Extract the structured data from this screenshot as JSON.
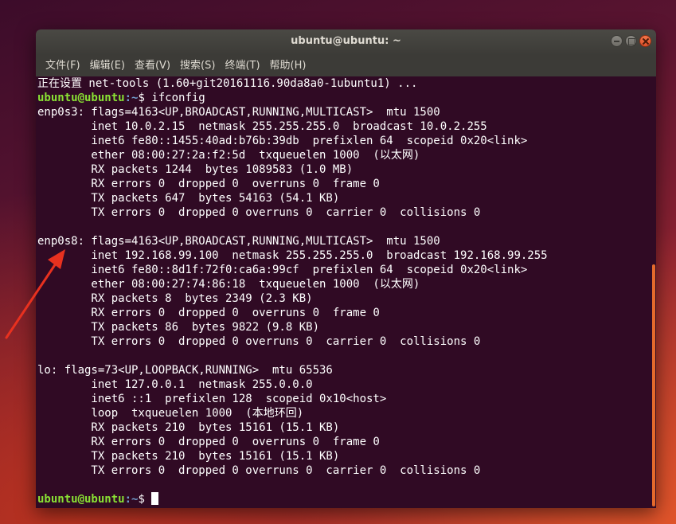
{
  "window": {
    "title": "ubuntu@ubuntu: ~"
  },
  "menu": {
    "items": [
      "文件(F)",
      "编辑(E)",
      "查看(V)",
      "搜索(S)",
      "终端(T)",
      "帮助(H)"
    ]
  },
  "terminal": {
    "prompt_user": "ubuntu@ubuntu",
    "prompt_path": ":~",
    "prompt_sign": "$ ",
    "lines": [
      "正在设置 net-tools (1.60+git20161116.90da8a0-1ubuntu1) ...",
      "",
      "enp0s3: flags=4163<UP,BROADCAST,RUNNING,MULTICAST>  mtu 1500",
      "        inet 10.0.2.15  netmask 255.255.255.0  broadcast 10.0.2.255",
      "        inet6 fe80::1455:40ad:b76b:39db  prefixlen 64  scopeid 0x20<link>",
      "        ether 08:00:27:2a:f2:5d  txqueuelen 1000  (以太网)",
      "        RX packets 1244  bytes 1089583 (1.0 MB)",
      "        RX errors 0  dropped 0  overruns 0  frame 0",
      "        TX packets 647  bytes 54163 (54.1 KB)",
      "        TX errors 0  dropped 0 overruns 0  carrier 0  collisions 0",
      "",
      "enp0s8: flags=4163<UP,BROADCAST,RUNNING,MULTICAST>  mtu 1500",
      "        inet 192.168.99.100  netmask 255.255.255.0  broadcast 192.168.99.255",
      "        inet6 fe80::8d1f:72f0:ca6a:99cf  prefixlen 64  scopeid 0x20<link>",
      "        ether 08:00:27:74:86:18  txqueuelen 1000  (以太网)",
      "        RX packets 8  bytes 2349 (2.3 KB)",
      "        RX errors 0  dropped 0  overruns 0  frame 0",
      "        TX packets 86  bytes 9822 (9.8 KB)",
      "        TX errors 0  dropped 0 overruns 0  carrier 0  collisions 0",
      "",
      "lo: flags=73<UP,LOOPBACK,RUNNING>  mtu 65536",
      "        inet 127.0.0.1  netmask 255.0.0.0",
      "        inet6 ::1  prefixlen 128  scopeid 0x10<host>",
      "        loop  txqueuelen 1000  (本地环回)",
      "        RX packets 210  bytes 15161 (15.1 KB)",
      "        RX errors 0  dropped 0  overruns 0  frame 0",
      "        TX packets 210  bytes 15161 (15.1 KB)",
      "        TX errors 0  dropped 0 overruns 0  carrier 0  collisions 0",
      "",
      ""
    ],
    "command_1": "ifconfig",
    "command_final": ""
  },
  "colors": {
    "terminal_bg": "#300a24",
    "prompt_user": "#8ae234",
    "prompt_path": "#729fcf",
    "annotation_arrow": "#e8311f",
    "scroll_thumb": "#e46a2c"
  },
  "icons": {
    "minimize": "minimize-icon",
    "maximize": "maximize-icon",
    "close": "close-icon",
    "arrow": "arrow-annotation"
  }
}
